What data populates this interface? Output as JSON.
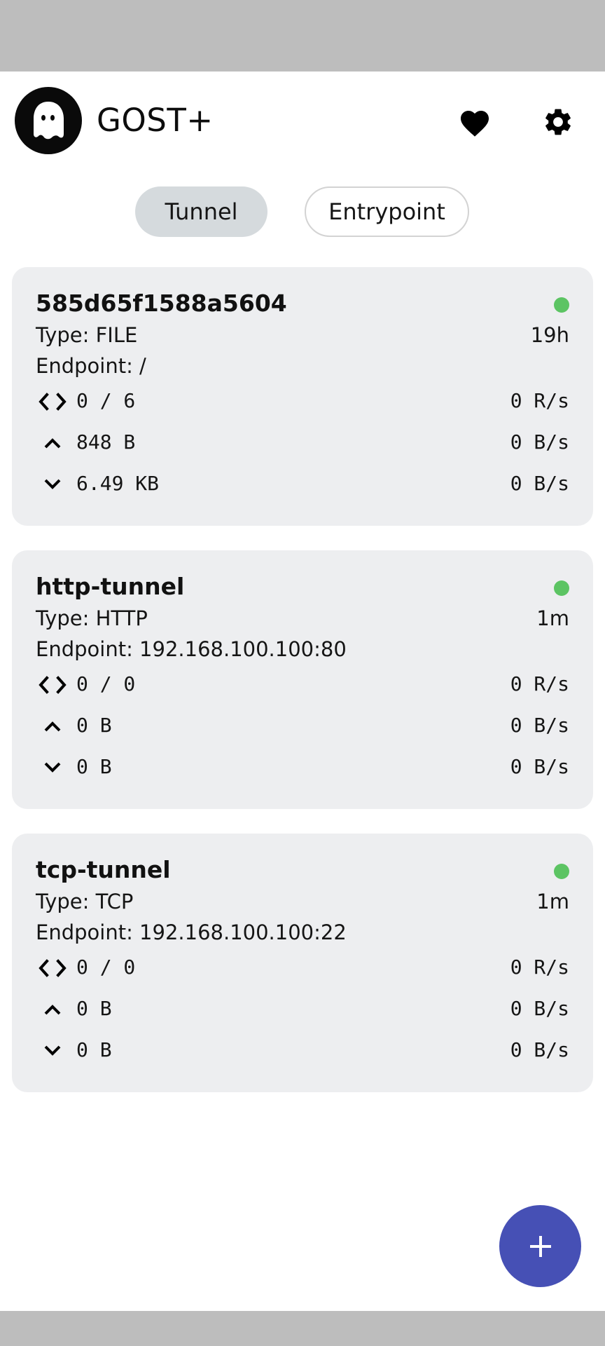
{
  "app": {
    "title": "GOST+"
  },
  "header": {
    "icons": {
      "logo": "ghost-logo",
      "favorite": "heart-icon",
      "settings": "gear-icon"
    }
  },
  "tabs": [
    {
      "label": "Tunnel",
      "selected": true
    },
    {
      "label": "Entrypoint",
      "selected": false
    }
  ],
  "tunnels": [
    {
      "name": "585d65f1588a5604",
      "type": "Type: FILE",
      "uptime": "19h",
      "endpoint": "Endpoint: /",
      "connections": "0 / 6",
      "request_rate": "0 R/s",
      "upload": "848 B",
      "upload_rate": "0 B/s",
      "download": "6.49 KB",
      "download_rate": "0 B/s",
      "status_color": "#5cc463"
    },
    {
      "name": "http-tunnel",
      "type": "Type: HTTP",
      "uptime": "1m",
      "endpoint": "Endpoint: 192.168.100.100:80",
      "connections": "0 / 0",
      "request_rate": "0 R/s",
      "upload": "0 B",
      "upload_rate": "0 B/s",
      "download": "0 B",
      "download_rate": "0 B/s",
      "status_color": "#5cc463"
    },
    {
      "name": "tcp-tunnel",
      "type": "Type: TCP",
      "uptime": "1m",
      "endpoint": "Endpoint: 192.168.100.100:22",
      "connections": "0 / 0",
      "request_rate": "0 R/s",
      "upload": "0 B",
      "upload_rate": "0 B/s",
      "download": "0 B",
      "download_rate": "0 B/s",
      "status_color": "#5cc463"
    }
  ],
  "fab": {
    "icon": "plus-icon"
  },
  "colors": {
    "accent": "#4650b5",
    "selected_tab": "#d5dadd",
    "card_bg": "#edeef0",
    "status_ok": "#5cc463"
  }
}
